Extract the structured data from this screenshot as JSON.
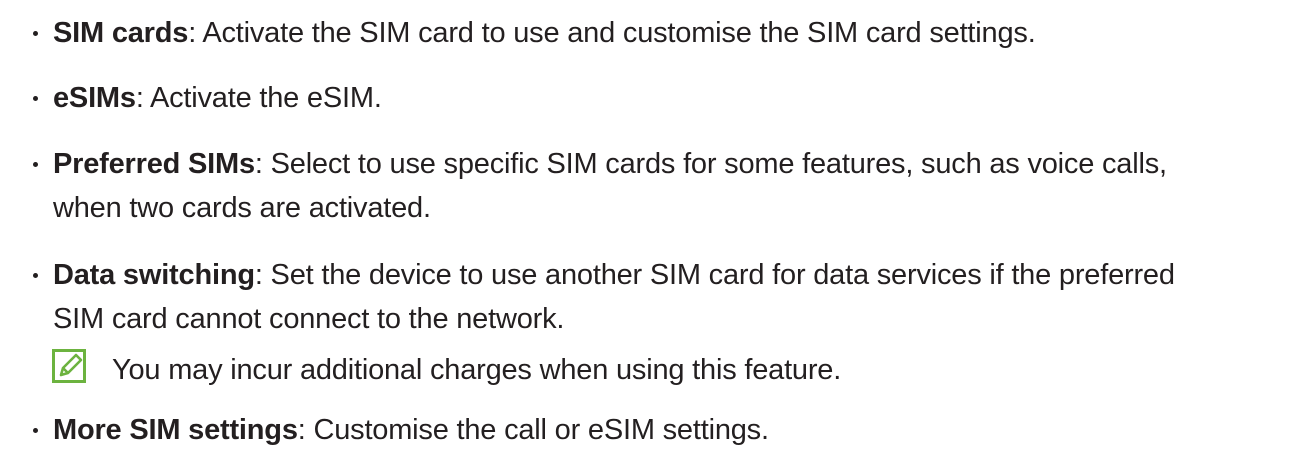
{
  "items": [
    {
      "term": "SIM cards",
      "separator": ":",
      "lines": [
        " Activate the SIM card to use and customise the SIM card settings."
      ]
    },
    {
      "term": "eSIMs",
      "separator": ":",
      "lines": [
        " Activate the eSIM."
      ]
    },
    {
      "term": "Preferred SIMs",
      "separator": ":",
      "lines": [
        " Select to use specific SIM cards for some features, such as voice calls,",
        "when two cards are activated."
      ]
    },
    {
      "term": "Data switching",
      "separator": ":",
      "lines": [
        " Set the device to use another SIM card for data services if the preferred",
        "SIM card cannot connect to the network."
      ]
    },
    {
      "term": "More SIM settings",
      "separator": ":",
      "lines": [
        " Customise the call or eSIM settings."
      ]
    }
  ],
  "note": {
    "icon": "note-pencil-icon",
    "text": "You may incur additional charges when using this feature."
  },
  "colors": {
    "text": "#231f20",
    "note_icon": "#6cb33f"
  }
}
